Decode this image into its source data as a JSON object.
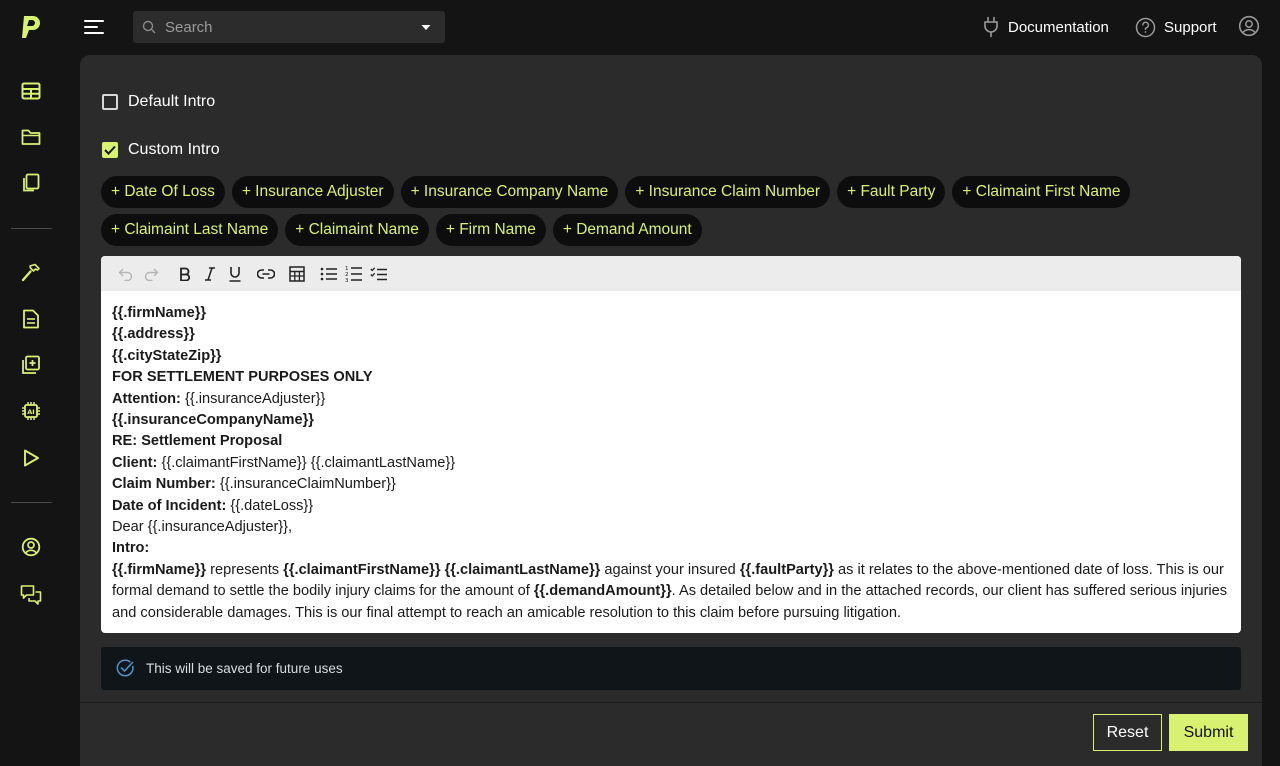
{
  "brand": {
    "logo_icon": "p-logo-icon",
    "accent": "#d9f171"
  },
  "rail": {
    "items": [
      {
        "name": "table-icon"
      },
      {
        "name": "folder-icon"
      },
      {
        "name": "copy-icon"
      },
      {
        "name": "hammer-icon"
      },
      {
        "name": "document-icon"
      },
      {
        "name": "add-file-icon"
      },
      {
        "name": "ai-chip-icon"
      },
      {
        "name": "play-icon"
      },
      {
        "name": "user-circle-icon"
      },
      {
        "name": "chat-icon"
      }
    ]
  },
  "topbar": {
    "search_placeholder": "Search",
    "documentation_label": "Documentation",
    "support_label": "Support"
  },
  "form": {
    "default_intro_label": "Default Intro",
    "default_intro_checked": false,
    "custom_intro_label": "Custom Intro",
    "custom_intro_checked": true,
    "chips": [
      "+ Date Of Loss",
      "+ Insurance Adjuster",
      "+ Insurance Company Name",
      "+ Insurance Claim Number",
      "+ Fault Party",
      "+ Claimaint First Name",
      "+ Claimaint Last Name",
      "+ Claimaint Name",
      "+ Firm Name",
      "+ Demand Amount"
    ]
  },
  "editor": {
    "lines": [
      [
        {
          "t": "{{.firmName}}",
          "b": true
        }
      ],
      [
        {
          "t": "{{.address}}",
          "b": true
        }
      ],
      [
        {
          "t": "{{.cityStateZip}}",
          "b": true
        }
      ],
      [
        {
          "t": "FOR SETTLEMENT PURPOSES ONLY",
          "b": true
        }
      ],
      [
        {
          "t": "Attention:",
          "b": true
        },
        {
          "t": " {{.insuranceAdjuster}}",
          "b": false
        }
      ],
      [
        {
          "t": "{{.insuranceCompanyName}}",
          "b": true
        }
      ],
      [
        {
          "t": "RE: Settlement Proposal",
          "b": true
        }
      ],
      [
        {
          "t": "Client:",
          "b": true
        },
        {
          "t": " {{.claimantFirstName}} {{.claimantLastName}}",
          "b": false
        }
      ],
      [
        {
          "t": "Claim Number:",
          "b": true
        },
        {
          "t": " {{.insuranceClaimNumber}}",
          "b": false
        }
      ],
      [
        {
          "t": "Date of Incident:",
          "b": true
        },
        {
          "t": " {{.dateLoss}}",
          "b": false
        }
      ],
      [
        {
          "t": "Dear {{.insuranceAdjuster}},",
          "b": false
        }
      ],
      [
        {
          "t": "Intro:",
          "b": true
        }
      ],
      [
        {
          "t": "{{.firmName}}",
          "b": true
        },
        {
          "t": " represents ",
          "b": false
        },
        {
          "t": "{{.claimantFirstName}} {{.claimantLastName}}",
          "b": true
        },
        {
          "t": " against your insured ",
          "b": false
        },
        {
          "t": "{{.faultParty}}",
          "b": true
        },
        {
          "t": " as it relates to the above-mentioned date of loss. This is our formal demand to settle the bodily injury claims for the amount of ",
          "b": false
        },
        {
          "t": "{{.demandAmount}}",
          "b": true
        },
        {
          "t": ". As detailed below and in the attached records, our client has suffered serious injuries and considerable damages. This is our final attempt to reach an amicable resolution to this claim before pursuing litigation.",
          "b": false
        }
      ]
    ]
  },
  "notice": {
    "text": "This will be saved for future uses"
  },
  "actions": {
    "reset_label": "Reset",
    "submit_label": "Submit"
  }
}
